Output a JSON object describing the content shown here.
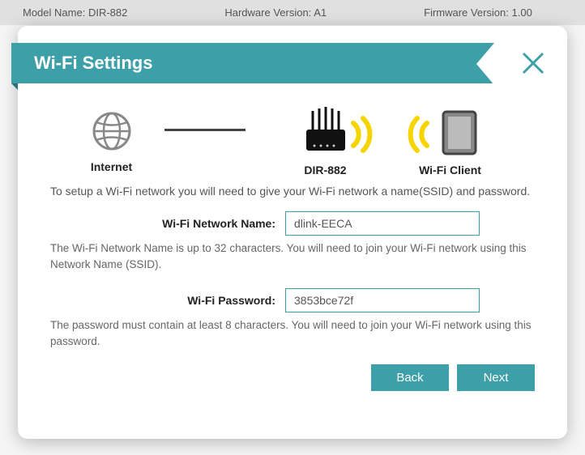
{
  "header": {
    "model_label": "Model Name:",
    "model_value": "DIR-882",
    "hw_label": "Hardware Version:",
    "hw_value": "A1",
    "fw_label": "Firmware Version:",
    "fw_value": "1.00"
  },
  "modal": {
    "title": "Wi-Fi Settings",
    "diagram": {
      "internet": "Internet",
      "router": "DIR-882",
      "client": "Wi-Fi Client"
    },
    "intro": "To setup a Wi-Fi network you will need to give your Wi-Fi network a name(SSID) and password.",
    "ssid_label": "Wi-Fi Network Name:",
    "ssid_value": "dlink-EECA",
    "ssid_help": "The Wi-Fi Network Name is up to 32 characters. You will need to join your Wi-Fi network using this Network Name (SSID).",
    "pwd_label": "Wi-Fi Password:",
    "pwd_value": "3853bce72f",
    "pwd_help": "The password must contain at least 8 characters. You will need to join your Wi-Fi network using this password.",
    "back": "Back",
    "next": "Next"
  }
}
